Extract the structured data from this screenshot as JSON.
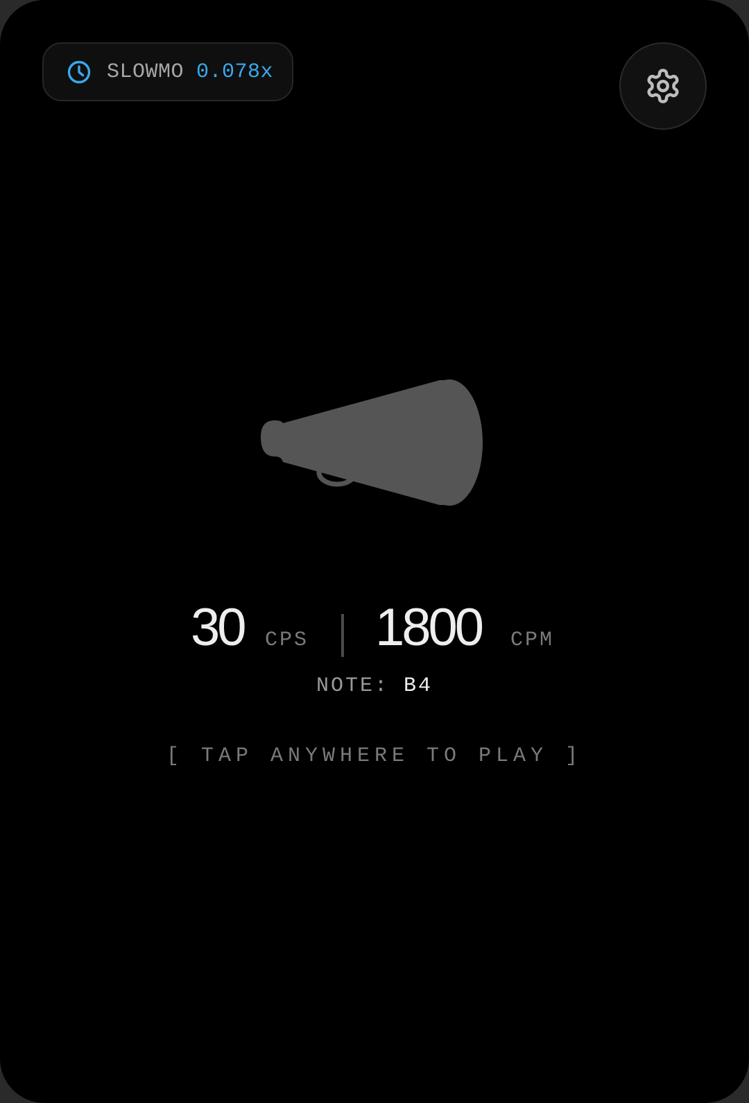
{
  "header": {
    "slowmo": {
      "icon": "clock-icon",
      "label": "SLOWMO",
      "value": "0.078x"
    },
    "settings": {
      "icon": "gear-icon"
    }
  },
  "main": {
    "instrument_icon": "megaphone-icon",
    "cps": {
      "value": "30",
      "unit": "CPS"
    },
    "cpm": {
      "value": "1800",
      "unit": "CPM"
    },
    "note": {
      "label": "NOTE:",
      "value": "B4"
    },
    "hint": "[ TAP ANYWHERE TO PLAY ]"
  },
  "colors": {
    "background": "#000000",
    "accent": "#3aa8ec",
    "icon_gray": "#555555",
    "text_primary": "#eeeeee",
    "text_muted": "#7a7a7a"
  }
}
